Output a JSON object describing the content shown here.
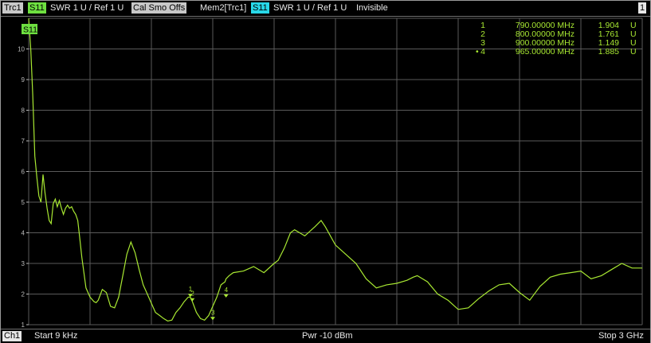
{
  "header": {
    "trace_label": "Trc1",
    "param_label": "S11",
    "format_text": "SWR  1 U /  Ref 1 U",
    "cal_text": "Cal Smo Offs",
    "mem_label": "Mem2[Trc1]",
    "mem_param_label": "S11",
    "mem_format_text": "SWR  1 U /  Ref 1 U",
    "mem_state": "Invisible",
    "window_number": "1"
  },
  "plot": {
    "trace_tag": "S11",
    "y_axis_ticks": [
      "1",
      "2",
      "3",
      "4",
      "5",
      "6",
      "7",
      "8",
      "9",
      "10"
    ],
    "marker_table": [
      {
        "id": "1",
        "active": false,
        "freq": "790.00000  MHz",
        "value": "1.904",
        "unit": "U"
      },
      {
        "id": "2",
        "active": false,
        "freq": "800.00000  MHz",
        "value": "1.761",
        "unit": "U"
      },
      {
        "id": "3",
        "active": false,
        "freq": "900.00000  MHz",
        "value": "1.149",
        "unit": "U"
      },
      {
        "id": "4",
        "active": true,
        "freq": "965.00000  MHz",
        "value": "1.885",
        "unit": "U"
      }
    ],
    "colors": {
      "trace": "#a8e832",
      "grid": "#5a5a5a",
      "text": "#e0e0e0"
    }
  },
  "footer": {
    "channel_label": "Ch1",
    "start_text": "Start  9 kHz",
    "power_text": "Pwr  -10 dBm",
    "stop_text": "Stop  3 GHz"
  },
  "chart_data": {
    "type": "line",
    "xlabel": "",
    "ylabel": "",
    "xlim": [
      9e-06,
      3.0
    ],
    "x_unit": "GHz",
    "ylim": [
      1,
      11
    ],
    "grid": true,
    "series": [
      {
        "x": [
          0.0,
          0.01,
          0.02,
          0.03,
          0.04,
          0.05,
          0.06,
          0.07,
          0.08,
          0.09,
          0.1,
          0.11,
          0.12,
          0.13,
          0.14,
          0.15,
          0.16,
          0.17,
          0.18,
          0.19,
          0.2,
          0.21,
          0.22,
          0.23,
          0.24,
          0.25,
          0.26,
          0.28,
          0.3,
          0.32,
          0.33,
          0.34,
          0.36,
          0.38,
          0.4,
          0.42,
          0.44,
          0.46,
          0.48,
          0.5,
          0.52,
          0.54,
          0.56,
          0.58,
          0.6,
          0.62,
          0.64,
          0.66,
          0.68,
          0.7,
          0.72,
          0.74,
          0.76,
          0.78,
          0.79,
          0.8,
          0.82,
          0.84,
          0.86,
          0.88,
          0.9,
          0.92,
          0.94,
          0.96,
          0.965,
          0.98,
          1.0,
          1.05,
          1.1,
          1.15,
          1.2,
          1.22,
          1.25,
          1.28,
          1.3,
          1.35,
          1.4,
          1.43,
          1.45,
          1.5,
          1.55,
          1.6,
          1.65,
          1.7,
          1.75,
          1.8,
          1.85,
          1.88,
          1.9,
          1.95,
          2.0,
          2.05,
          2.1,
          2.15,
          2.2,
          2.25,
          2.3,
          2.35,
          2.4,
          2.45,
          2.5,
          2.55,
          2.6,
          2.65,
          2.7,
          2.75,
          2.8,
          2.85,
          2.9,
          2.95,
          3.0
        ],
        "y": [
          11.2,
          10.0,
          8.5,
          6.5,
          5.8,
          5.2,
          5.0,
          5.9,
          5.3,
          4.8,
          4.4,
          4.3,
          4.95,
          5.1,
          4.85,
          5.05,
          4.8,
          4.6,
          4.8,
          4.9,
          4.8,
          4.85,
          4.7,
          4.6,
          4.4,
          3.8,
          3.2,
          2.2,
          1.9,
          1.75,
          1.72,
          1.8,
          2.15,
          2.05,
          1.6,
          1.55,
          1.9,
          2.6,
          3.3,
          3.7,
          3.35,
          2.8,
          2.3,
          2.0,
          1.7,
          1.4,
          1.3,
          1.2,
          1.12,
          1.15,
          1.4,
          1.55,
          1.75,
          1.9,
          1.904,
          1.761,
          1.4,
          1.2,
          1.149,
          1.3,
          1.6,
          1.9,
          2.3,
          2.4,
          2.5,
          2.6,
          2.7,
          2.75,
          2.9,
          2.7,
          3.0,
          3.1,
          3.5,
          4.0,
          4.1,
          3.9,
          4.2,
          4.4,
          4.2,
          3.6,
          3.3,
          3.0,
          2.5,
          2.2,
          2.3,
          2.35,
          2.45,
          2.55,
          2.6,
          2.4,
          2.0,
          1.8,
          1.5,
          1.55,
          1.85,
          2.1,
          2.3,
          2.35,
          2.05,
          1.8,
          2.25,
          2.55,
          2.65,
          2.7,
          2.75,
          2.5,
          2.6,
          2.8,
          3.0,
          2.85,
          2.85
        ]
      }
    ],
    "markers": [
      {
        "id": "1",
        "x": 0.79,
        "y": 1.904
      },
      {
        "id": "2",
        "x": 0.8,
        "y": 1.761
      },
      {
        "id": "3",
        "x": 0.9,
        "y": 1.149
      },
      {
        "id": "4",
        "x": 0.965,
        "y": 1.885
      }
    ]
  }
}
